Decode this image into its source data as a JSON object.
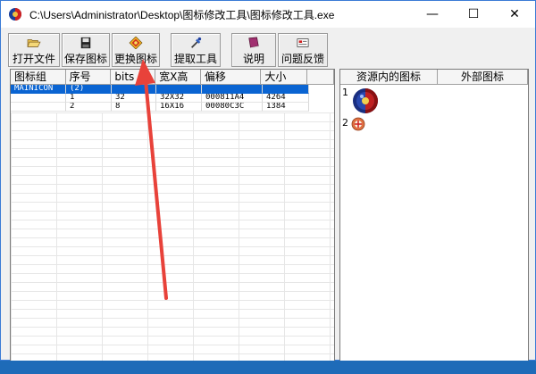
{
  "window": {
    "title": "C:\\Users\\Administrator\\Desktop\\图标修改工具\\图标修改工具.exe",
    "minimize_glyph": "—",
    "maximize_glyph": "☐",
    "close_glyph": "✕"
  },
  "toolbar": {
    "buttons": [
      {
        "label": "打开文件",
        "icon": "folder-open-icon"
      },
      {
        "label": "保存图标",
        "icon": "floppy-disk-icon"
      },
      {
        "label": "更换图标",
        "icon": "swap-diamond-icon"
      },
      {
        "label": "提取工具",
        "icon": "eyedropper-icon"
      },
      {
        "label": "说明",
        "icon": "book-icon"
      },
      {
        "label": "问题反馈",
        "icon": "feedback-envelope-icon"
      }
    ]
  },
  "table": {
    "headers": [
      "图标组",
      "序号",
      "bits",
      "宽X高",
      "偏移",
      "大小"
    ],
    "rows": [
      {
        "group": "MAINICON",
        "index": "(2)",
        "bits": "",
        "size_wh": "",
        "offset": "",
        "size": "",
        "selected": true
      },
      {
        "group": "",
        "index": "1",
        "bits": "32",
        "size_wh": "32X32",
        "offset": "000811A4",
        "size": "4264",
        "selected": false
      },
      {
        "group": "",
        "index": "2",
        "bits": "8",
        "size_wh": "16X16",
        "offset": "00080C3C",
        "size": "1384",
        "selected": false
      }
    ]
  },
  "right_panel": {
    "headers": [
      "资源内的图标",
      "外部图标"
    ],
    "items": [
      {
        "number": "1",
        "icon": "large-app-icon"
      },
      {
        "number": "2",
        "icon": "small-app-icon"
      }
    ]
  },
  "colors": {
    "selection": "#0a64d2",
    "arrow": "#e8423a",
    "desktop": "#1e6bb8"
  }
}
